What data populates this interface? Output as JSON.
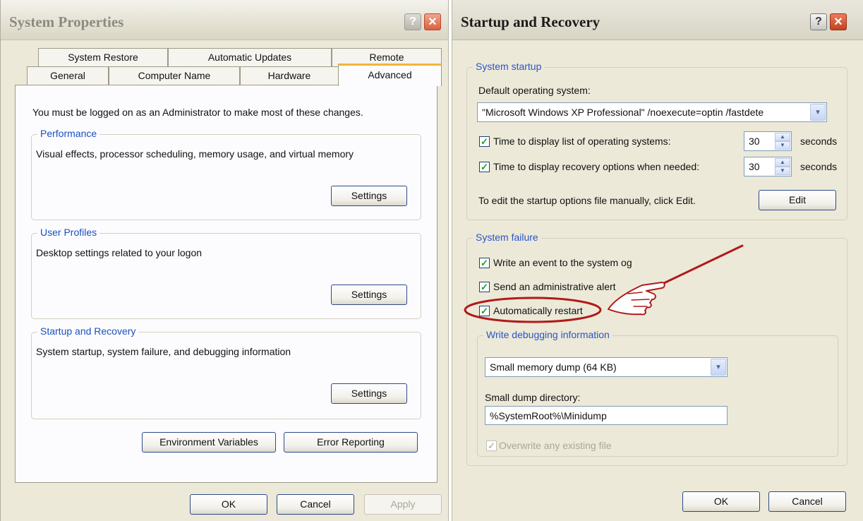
{
  "sys_props": {
    "title": "System Properties",
    "tabs_row1": [
      "System Restore",
      "Automatic Updates",
      "Remote"
    ],
    "tabs_row2": [
      "General",
      "Computer Name",
      "Hardware",
      "Advanced"
    ],
    "active_tab": "Advanced",
    "intro": "You must be logged on as an Administrator to make most of these changes.",
    "performance": {
      "legend": "Performance",
      "desc": "Visual effects, processor scheduling, memory usage, and virtual memory",
      "button": "Settings"
    },
    "user_profiles": {
      "legend": "User Profiles",
      "desc": "Desktop settings related to your logon",
      "button": "Settings"
    },
    "startup_recovery": {
      "legend": "Startup and Recovery",
      "desc": "System startup, system failure, and debugging information",
      "button": "Settings"
    },
    "env_vars_button": "Environment Variables",
    "error_reporting_button": "Error Reporting",
    "ok_button": "OK",
    "cancel_button": "Cancel",
    "apply_button": "Apply"
  },
  "startup_recovery_dialog": {
    "title": "Startup and Recovery",
    "system_startup": {
      "legend": "System startup",
      "default_os_label": "Default operating system:",
      "default_os_value": "\"Microsoft Windows XP Professional\" /noexecute=optin /fastdete",
      "display_list": {
        "label": "Time to display list of operating systems:",
        "checked": true,
        "value": "30",
        "unit": "seconds"
      },
      "display_recovery": {
        "label": "Time to display recovery options when needed:",
        "checked": true,
        "value": "30",
        "unit": "seconds"
      },
      "edit_text": "To edit the startup options file manually, click Edit.",
      "edit_button": "Edit"
    },
    "system_failure": {
      "legend": "System failure",
      "write_event": {
        "label": "Write an event to the system og",
        "checked": true
      },
      "admin_alert": {
        "label": "Send an administrative alert",
        "checked": true
      },
      "auto_restart": {
        "label": "Automatically restart",
        "checked": true
      },
      "debug": {
        "legend": "Write debugging information",
        "dump_type": "Small memory dump (64 KB)",
        "dir_label": "Small dump directory:",
        "dir_value": "%SystemRoot%\\Minidump",
        "overwrite": {
          "label": "Overwrite any existing file",
          "checked": true,
          "disabled": true
        }
      }
    },
    "ok_button": "OK",
    "cancel_button": "Cancel"
  },
  "annotation": {
    "highlight_color": "#b01a1a"
  },
  "icons": {
    "check": "✓",
    "dropdown": "▾",
    "spin_up": "▲",
    "spin_down": "▼",
    "help": "?",
    "close": "✕"
  }
}
